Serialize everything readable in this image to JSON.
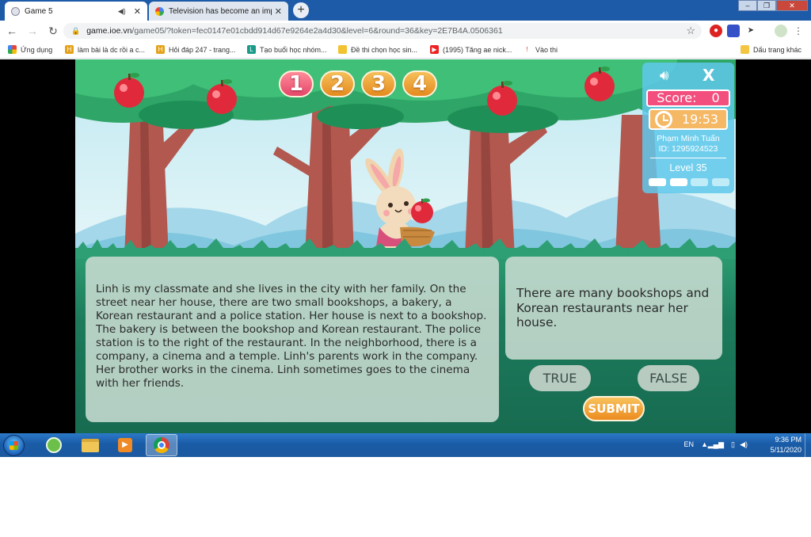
{
  "browser": {
    "tabs": [
      {
        "title": "Game 5",
        "active": true
      },
      {
        "title": "Television has become an import",
        "active": false
      }
    ],
    "url_host": "game.ioe.vn",
    "url_rest": "/game05/?token=fec0147e01cbdd914d67e9264e2a4d30&level=6&round=36&key=2E7B4A.0506361",
    "bookmarks": [
      "Ứng dụng",
      "làm bài là dc rồi a c...",
      "Hỏi đáp 247 - trang...",
      "Tạo buổi học nhóm...",
      "Đề thi chọn học sin...",
      "(1995) Tăng ae nick...",
      "Vào thi"
    ],
    "other_bookmarks": "Dấu trang khác"
  },
  "game": {
    "question_numbers": [
      "1",
      "2",
      "3",
      "4"
    ],
    "current_question": 1,
    "score_label": "Score:",
    "score_value": "0",
    "timer": "19:53",
    "player_name": "Phạm Minh Tuấn",
    "player_id": "ID: 1295924523",
    "level": "Level 35",
    "progress_dots_filled": 2,
    "progress_dots_total": 4,
    "passage": "Linh is my classmate and she lives in the city with her family. On the street near her house, there are two small bookshops, a bakery, a Korean restaurant and a police station. Her house is next to a bookshop. The bakery is between the bookshop and Korean restaurant. The police station is to the right of the restaurant. In the neighborhood, there is a company, a cinema and a temple. Linh's parents work in the company. Her brother works in the cinema. Linh sometimes goes to the cinema with her friends.",
    "statement": "There are many bookshops and Korean restaurants near her house.",
    "true_label": "TRUE",
    "false_label": "FALSE",
    "submit_label": "SUBMIT"
  },
  "taskbar": {
    "language": "EN",
    "time": "9:36 PM",
    "date": "5/11/2020"
  },
  "colors": {
    "score_bg": "#f24e7e",
    "timer_bg": "#f5b865",
    "button_orange": "#eb8b1f",
    "ground": "#1c7a5b"
  }
}
